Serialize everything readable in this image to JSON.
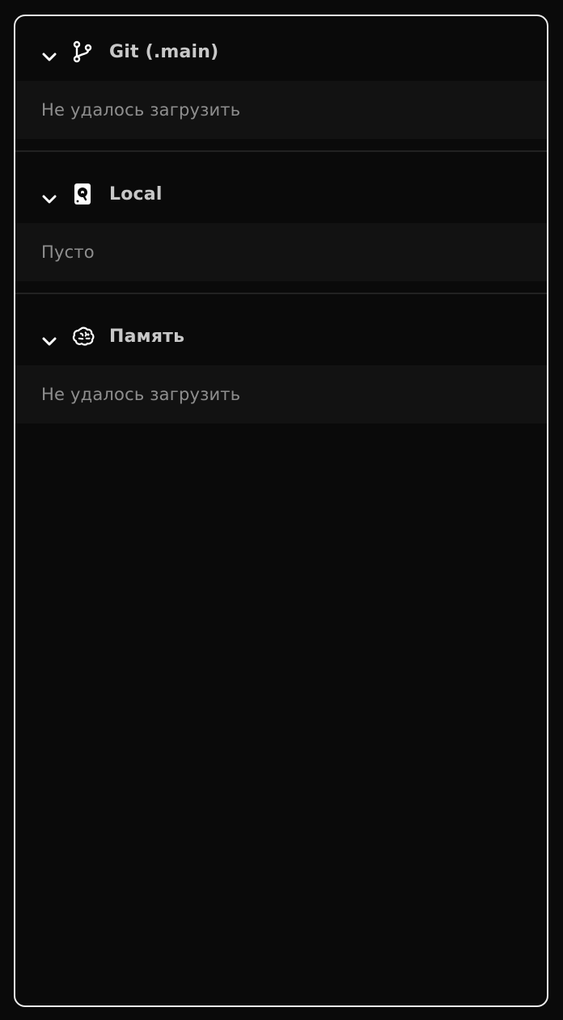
{
  "panel": {
    "sections": [
      {
        "title": "Git (.main)",
        "icon": "git-branch-icon",
        "expanded": true,
        "body": "Не удалось загрузить"
      },
      {
        "title": "Local",
        "icon": "hard-drive-icon",
        "expanded": true,
        "body": "Пусто"
      },
      {
        "title": "Память",
        "icon": "brain-icon",
        "expanded": true,
        "body": "Не удалось загрузить"
      }
    ]
  },
  "colors": {
    "background": "#0a0a0a",
    "panel_border": "#ececec",
    "body_bg": "#121212",
    "title_text": "#c8c8c8",
    "body_text": "#8e8e8e",
    "divider": "#222222"
  }
}
